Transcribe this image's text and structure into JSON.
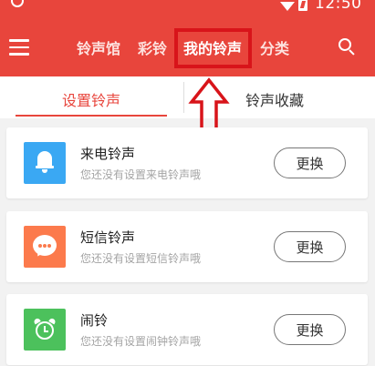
{
  "status_bar": {
    "time": "12:50"
  },
  "app_bar": {
    "tabs": [
      {
        "label": "铃声馆",
        "active": false
      },
      {
        "label": "彩铃",
        "active": false
      },
      {
        "label": "我的铃声",
        "active": true
      },
      {
        "label": "分类",
        "active": false
      }
    ]
  },
  "sub_tabs": [
    {
      "label": "设置铃声",
      "active": true
    },
    {
      "label": "铃声收藏",
      "active": false
    }
  ],
  "cards": [
    {
      "title": "来电铃声",
      "desc": "您还没有设置来电铃声哦",
      "button": "更换",
      "icon": "bell-icon",
      "color": "#3aa8f3"
    },
    {
      "title": "短信铃声",
      "desc": "您还没有设置短信铃声哦",
      "button": "更换",
      "icon": "message-bubble-icon",
      "color": "#fc7a4c"
    },
    {
      "title": "闹铃",
      "desc": "您还没有设置闹钟铃声哦",
      "button": "更换",
      "icon": "alarm-clock-icon",
      "color": "#4cc15c"
    }
  ],
  "colors": {
    "brand": "#e8453c",
    "highlight": "#d8141a"
  }
}
